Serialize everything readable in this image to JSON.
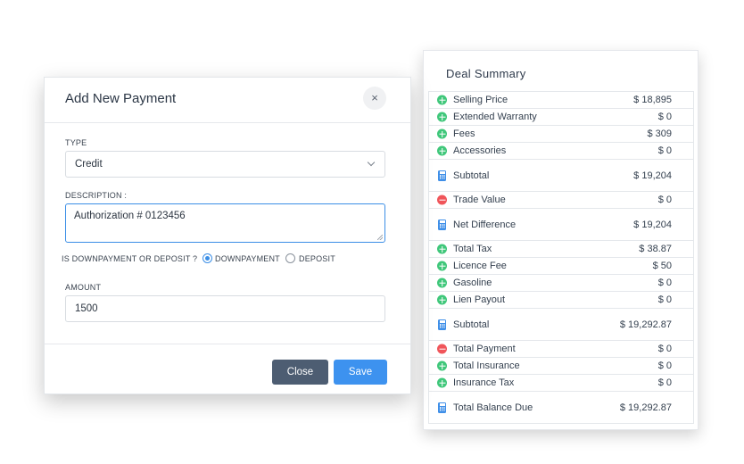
{
  "deal_summary": {
    "title": "Deal Summary",
    "rows": [
      {
        "label": "Selling Price",
        "value": "$ 18,895",
        "icon": "plus-circle-icon"
      },
      {
        "label": "Extended Warranty",
        "value": "$ 0",
        "icon": "plus-circle-icon"
      },
      {
        "label": "Fees",
        "value": "$ 309",
        "icon": "plus-circle-icon"
      },
      {
        "label": "Accessories",
        "value": "$ 0",
        "icon": "plus-circle-icon"
      },
      {
        "label": "Subtotal",
        "value": "$ 19,204",
        "icon": "calculator-icon"
      },
      {
        "label": "Trade Value",
        "value": "$ 0",
        "icon": "minus-circle-icon"
      },
      {
        "label": "Net Difference",
        "value": "$ 19,204",
        "icon": "calculator-icon"
      },
      {
        "label": "Total Tax",
        "value": "$ 38.87",
        "icon": "plus-circle-icon"
      },
      {
        "label": "Licence Fee",
        "value": "$ 50",
        "icon": "plus-circle-icon"
      },
      {
        "label": "Gasoline",
        "value": "$ 0",
        "icon": "plus-circle-icon"
      },
      {
        "label": "Lien Payout",
        "value": "$ 0",
        "icon": "plus-circle-icon"
      },
      {
        "label": "Subtotal",
        "value": "$ 19,292.87",
        "icon": "calculator-icon"
      },
      {
        "label": "Total Payment",
        "value": "$ 0",
        "icon": "minus-circle-icon"
      },
      {
        "label": "Total Insurance",
        "value": "$ 0",
        "icon": "plus-circle-icon"
      },
      {
        "label": "Insurance Tax",
        "value": "$ 0",
        "icon": "plus-circle-icon"
      },
      {
        "label": "Total Balance Due",
        "value": "$ 19,292.87",
        "icon": "calculator-icon"
      }
    ]
  },
  "modal": {
    "title": "Add New Payment",
    "close_icon": "×",
    "type_label": "TYPE",
    "type_value": "Credit",
    "description_label": "DESCRIPTION :",
    "description_value": "Authorization # 0123456",
    "radio_question": "IS DOWNPAYMENT OR DEPOSIT ?",
    "radio_options": [
      {
        "label": "DOWNPAYMENT",
        "selected": true
      },
      {
        "label": "DEPOSIT",
        "selected": false
      }
    ],
    "amount_label": "AMOUNT",
    "amount_value": "1500",
    "close_button": "Close",
    "save_button": "Save"
  },
  "colors": {
    "plus": "#3fc77a",
    "minus": "#f0555a",
    "calculator": "#3f8fe8",
    "primary": "#3d92ef",
    "secondary": "#4d5d72"
  }
}
